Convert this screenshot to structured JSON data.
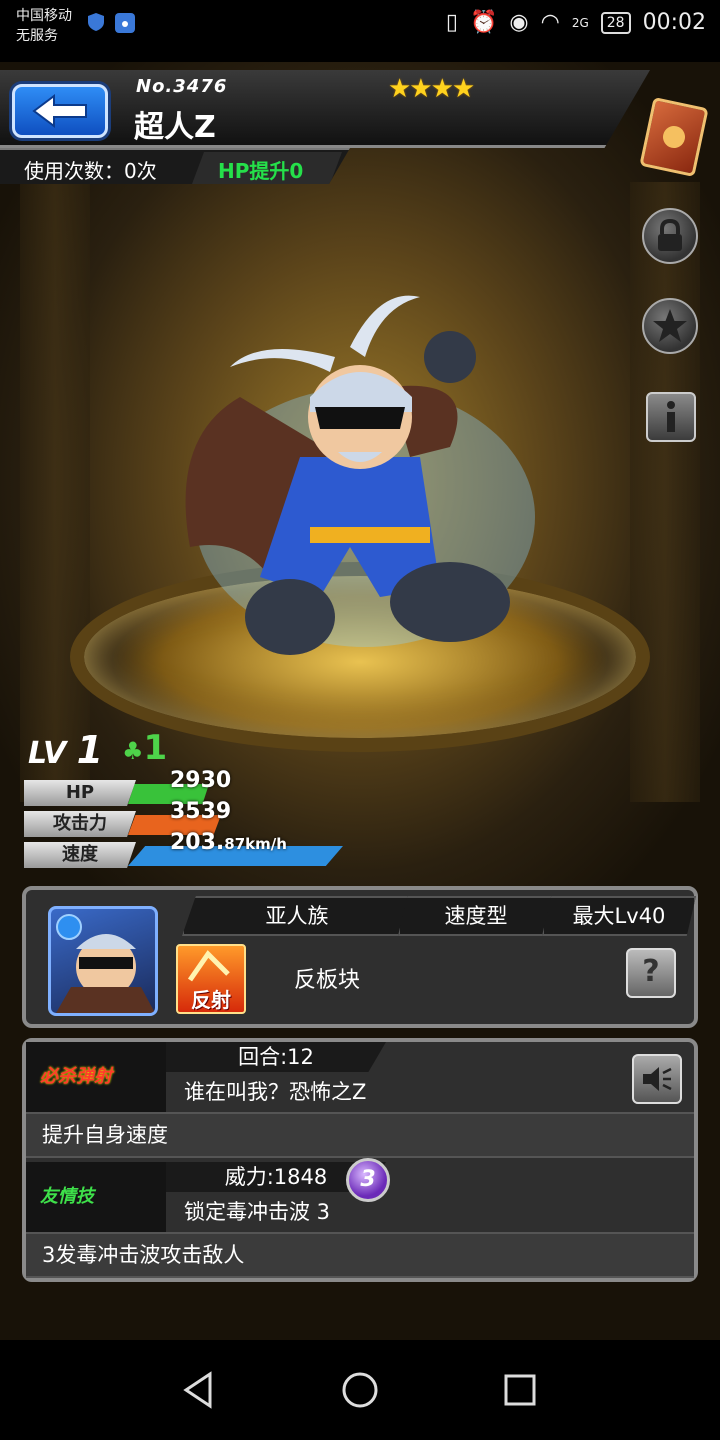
{
  "status_bar": {
    "carrier": "中国移动",
    "service": "无服务",
    "network": "2G",
    "battery": "28",
    "time": "00:02"
  },
  "header": {
    "monster_number": "No.3476",
    "monster_name": "超人Z",
    "stars": "★★★★",
    "usage_label": "使用次数：0次",
    "hp_boost": "HP提升0"
  },
  "stats": {
    "level_prefix": "LV",
    "level": "1",
    "luck": "1",
    "rows": [
      {
        "label": "HP",
        "value": "2930",
        "unit": "",
        "color": "#39c23a",
        "fill": 0.28
      },
      {
        "label": "攻击力",
        "value": "3539",
        "unit": "",
        "color": "#e8641e",
        "fill": 0.32
      },
      {
        "label": "速度",
        "value": "203.",
        "unit": "87km/h",
        "color": "#2d8fe0",
        "fill": 0.74
      }
    ]
  },
  "info_panel": {
    "tribe": "亚人族",
    "type": "速度型",
    "max_level": "最大Lv40",
    "ability_icon_label": "反射",
    "ability_name": "反板块",
    "help_label": "?"
  },
  "skills": {
    "strike": {
      "type_label": "必杀弹射",
      "turns": "回合:12",
      "name": "谁在叫我？恐怖之Z",
      "description": "提升自身速度"
    },
    "friendship": {
      "type_label": "友情技",
      "power": "威力:1848",
      "name": "锁定毒冲击波 3",
      "level": "3",
      "description": "3发毒冲击波攻击敌人"
    }
  }
}
